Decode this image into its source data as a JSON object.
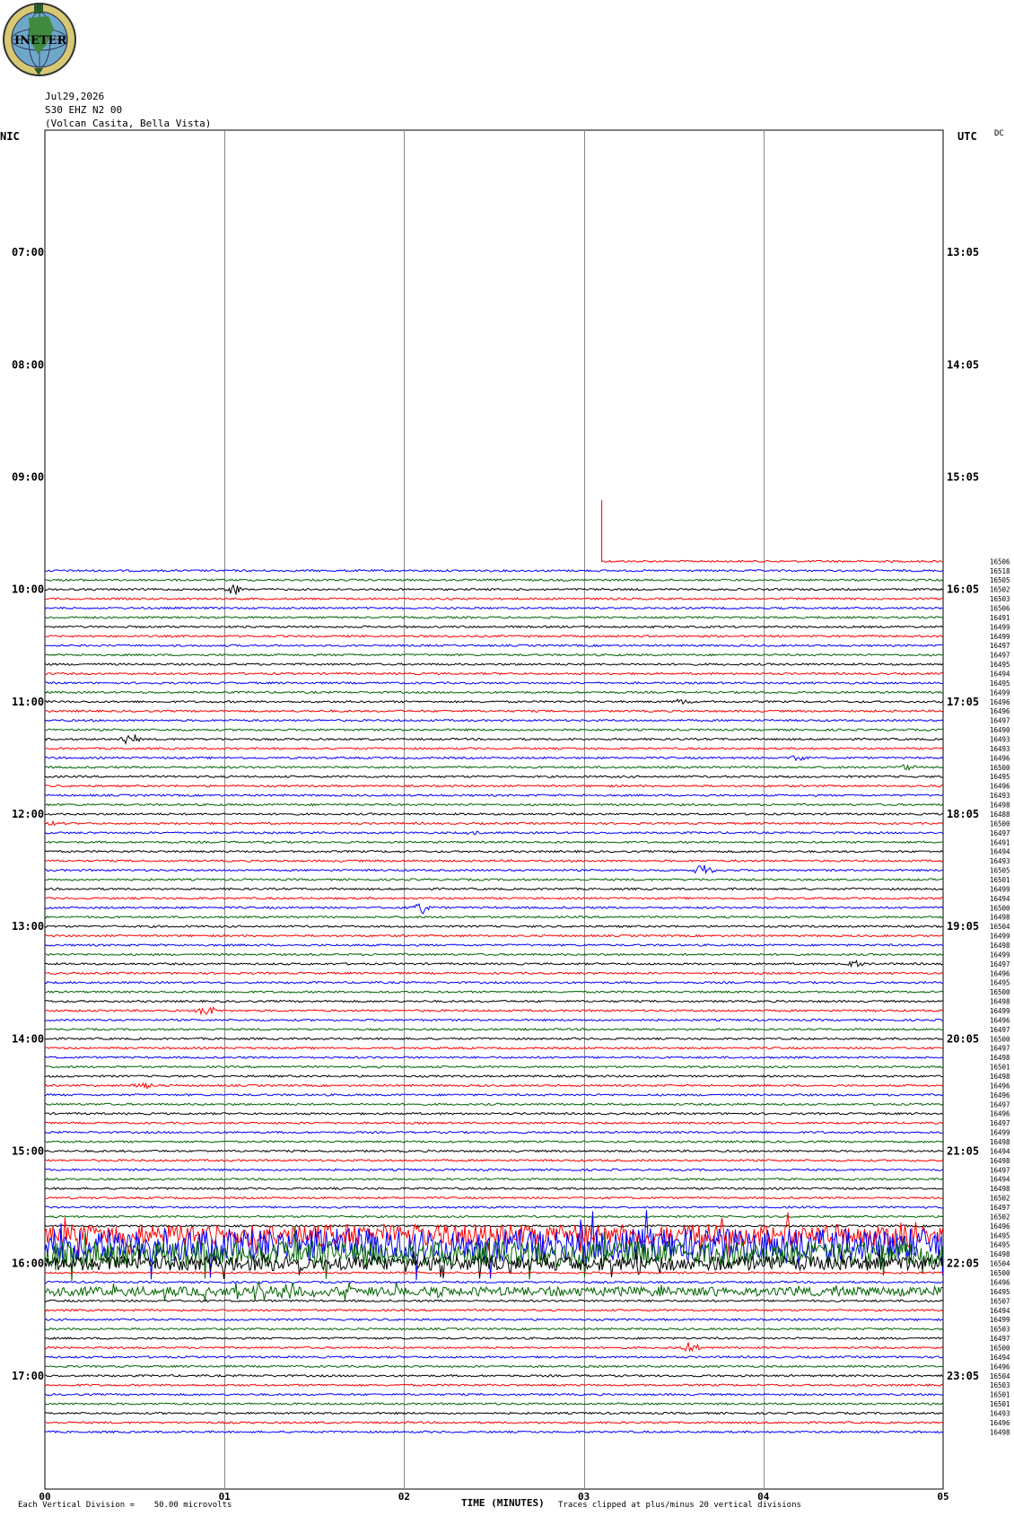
{
  "logo": {
    "text": "INETER"
  },
  "header": {
    "date": "Jul29,2026",
    "station": "S30 EHZ N2 00",
    "location": "(Volcan Casita, Bella Vista)"
  },
  "labels": {
    "left_zone": "NIC",
    "right_zone": "UTC",
    "corner": "DC",
    "xlabel": "TIME (MINUTES)",
    "scale_note": "Each Vertical Division =    50.00 microvolts",
    "clip_note": "Traces clipped at plus/minus 20 vertical divisions"
  },
  "chart_data": {
    "type": "line",
    "title": "S30 EHZ N2 00 (Volcan Casita, Bella Vista)",
    "xlabel": "TIME (MINUTES)",
    "xlim": [
      0,
      5
    ],
    "x_ticks": [
      "00",
      "01",
      "02",
      "03",
      "04",
      "05"
    ],
    "left_hour_ticks": [
      "07:00",
      "08:00",
      "09:00",
      "10:00",
      "11:00",
      "12:00",
      "13:00",
      "14:00",
      "15:00",
      "16:00",
      "17:00"
    ],
    "right_hour_ticks": [
      "13:05",
      "14:05",
      "15:05",
      "16:05",
      "17:05",
      "18:05",
      "19:05",
      "20:05",
      "21:05",
      "22:05",
      "23:05"
    ],
    "first_row_hour": 6,
    "minutes_per_row": 5,
    "data_start_row": 45,
    "data_start_minute": 3.1,
    "trace_colors": [
      "#000000",
      "#ff0000",
      "#0000ff",
      "#006400"
    ],
    "row_mean_values": [
      "16506",
      "16518",
      "16505",
      "16502",
      "16503",
      "16506",
      "16491",
      "16499",
      "16499",
      "16497",
      "16497",
      "16495",
      "16494",
      "16495",
      "16499",
      "16496",
      "16496",
      "16497",
      "16490",
      "16493",
      "16493",
      "16496",
      "16500",
      "16495",
      "16496",
      "16493",
      "16498",
      "16488",
      "16500",
      "16497",
      "16491",
      "16494",
      "16493",
      "16505",
      "16501",
      "16499",
      "16494",
      "16500",
      "16498",
      "16504",
      "16499",
      "16498",
      "16499",
      "16497",
      "16496",
      "16495",
      "16500",
      "16498",
      "16499",
      "16496",
      "16497",
      "16500",
      "16497",
      "16498",
      "16501",
      "16498",
      "16496",
      "16496",
      "16497",
      "16496",
      "16497",
      "16499",
      "16498",
      "16494",
      "16498",
      "16497",
      "16494",
      "16498",
      "16502",
      "16497",
      "16502",
      "16496",
      "16495",
      "16495",
      "16498",
      "16504",
      "16500",
      "16496",
      "16495",
      "16507",
      "16494",
      "16499",
      "16503",
      "16497",
      "16500",
      "16494",
      "16496",
      "16504",
      "16503",
      "16501",
      "16501",
      "16493",
      "16496",
      "16498"
    ],
    "events": [
      {
        "row": 48,
        "minute": 1.05,
        "amp": 8
      },
      {
        "row": 60,
        "minute": 3.55,
        "amp": 4
      },
      {
        "row": 64,
        "minute": 0.47,
        "amp": 8
      },
      {
        "row": 66,
        "minute": 4.2,
        "amp": 4
      },
      {
        "row": 67,
        "minute": 4.8,
        "amp": 4
      },
      {
        "row": 73,
        "minute": 0.05,
        "amp": 4
      },
      {
        "row": 74,
        "minute": 2.4,
        "amp": 5
      },
      {
        "row": 78,
        "minute": 3.67,
        "amp": 8
      },
      {
        "row": 82,
        "minute": 2.1,
        "amp": 7
      },
      {
        "row": 88,
        "minute": 4.5,
        "amp": 5
      },
      {
        "row": 93,
        "minute": 0.9,
        "amp": 8
      },
      {
        "row": 101,
        "minute": 0.55,
        "amp": 5
      },
      {
        "row": 117,
        "minute": 4.78,
        "amp": 16
      },
      {
        "row": 119,
        "minute": 1.1,
        "amp": 9
      },
      {
        "row": 123,
        "minute": 1.2,
        "amp": 11
      },
      {
        "row": 123,
        "minute": 1.35,
        "amp": 9
      },
      {
        "row": 129,
        "minute": 3.6,
        "amp": 7
      }
    ],
    "active_rows": [
      {
        "row": 117,
        "amp": 12
      },
      {
        "row": 118,
        "amp": 18
      },
      {
        "row": 119,
        "amp": 14
      },
      {
        "row": 120,
        "amp": 8
      },
      {
        "row": 123,
        "amp": 5
      }
    ]
  }
}
